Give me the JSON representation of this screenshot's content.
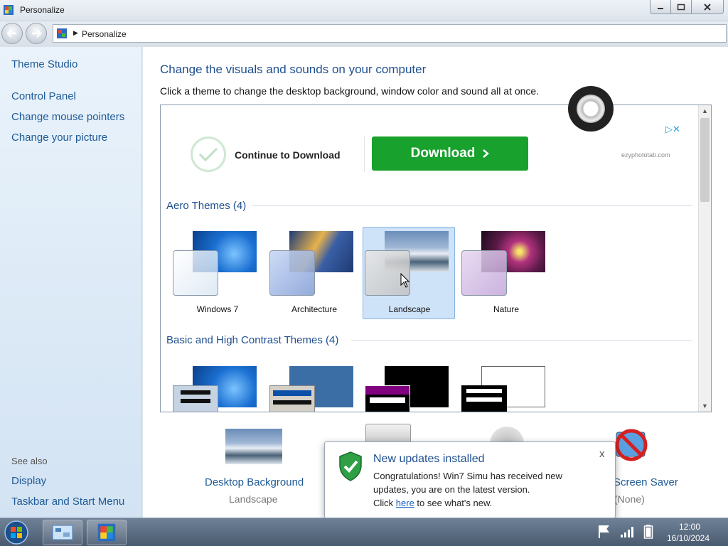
{
  "window": {
    "title": "Personalize"
  },
  "address": {
    "crumb": "Personalize"
  },
  "sidebar": {
    "links": [
      "Theme Studio",
      "Control Panel",
      "Change mouse pointers",
      "Change your picture"
    ],
    "see_also_label": "See also",
    "see_also": [
      "Display",
      "Taskbar and Start Menu"
    ]
  },
  "main": {
    "heading": "Change the visuals and sounds on your computer",
    "subheading": "Click a theme to change the desktop background, window color and sound all at once.",
    "ad": {
      "continue_label": "Continue to Download",
      "download_label": "Download",
      "site": "ezyphototab.com"
    },
    "aero_title": "Aero Themes (4)",
    "aero_themes": [
      {
        "label": "Windows 7",
        "selected": false
      },
      {
        "label": "Architecture",
        "selected": false
      },
      {
        "label": "Landscape",
        "selected": true
      },
      {
        "label": "Nature",
        "selected": false
      }
    ],
    "basic_title": "Basic and High Contrast Themes (4)"
  },
  "bottom": {
    "desktop_background": {
      "label": "Desktop Background",
      "value": "Landscape"
    },
    "screen_saver": {
      "label": "Screen Saver",
      "value": "(None)"
    }
  },
  "notification": {
    "title": "New updates installed",
    "line1": "Congratulations! Win7 Simu has received new",
    "line2": "updates, you are on the latest version.",
    "line3_pre": "Click ",
    "line3_link": "here",
    "line3_post": " to see what's new.",
    "close": "x"
  },
  "taskbar": {
    "time": "12:00",
    "date": "16/10/2024"
  },
  "colors": {
    "accent": "#1e4f8f",
    "link": "#1e5a96",
    "download": "#18a12c",
    "selected": "#cfe3f8"
  }
}
